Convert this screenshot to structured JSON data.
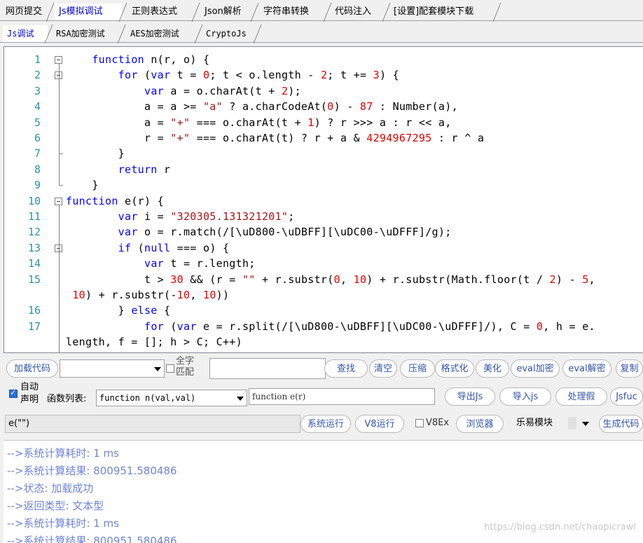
{
  "tabs": [
    "网页提交",
    "Js模拟调试",
    "正则表达式",
    "Json解析",
    "字符串转换",
    "代码注入",
    "[设置]配套模块下载"
  ],
  "subtabs": [
    "Js调试",
    "RSA加密测试",
    "AES加密测试",
    "CryptoJs"
  ],
  "code_lines": [
    {
      "n": "1",
      "text": "    function n(r, o) {"
    },
    {
      "n": "2",
      "text": "        for (var t = 0; t < o.length - 2; t += 3) {"
    },
    {
      "n": "3",
      "text": "            var a = o.charAt(t + 2);"
    },
    {
      "n": "4",
      "text": "            a = a >= \"a\" ? a.charCodeAt(0) - 87 : Number(a),"
    },
    {
      "n": "5",
      "text": "            a = \"+\" === o.charAt(t + 1) ? r >>> a : r << a,"
    },
    {
      "n": "6",
      "text": "            r = \"+\" === o.charAt(t) ? r + a & 4294967295 : r ^ a"
    },
    {
      "n": "7",
      "text": "        }"
    },
    {
      "n": "8",
      "text": "        return r"
    },
    {
      "n": "9",
      "text": "    }"
    },
    {
      "n": "10",
      "text": "function e(r) {"
    },
    {
      "n": "11",
      "text": "        var i = \"320305.131321201\";"
    },
    {
      "n": "12",
      "text": "        var o = r.match(/[\\uD800-\\uDBFF][\\uDC00-\\uDFFF]/g);"
    },
    {
      "n": "13",
      "text": "        if (null === o) {"
    },
    {
      "n": "14",
      "text": "            var t = r.length;"
    },
    {
      "n": "15",
      "text": "            t > 30 && (r = \"\" + r.substr(0, 10) + r.substr(Math.floor(t / 2) - 5,"
    },
    {
      "n": "",
      "text": " 10) + r.substr(-10, 10))"
    },
    {
      "n": "16",
      "text": "        } else {"
    },
    {
      "n": "17",
      "text": "            for (var e = r.split(/[\\uD800-\\uDBFF][\\uDC00-\\uDFFF]/), C = 0, h = e."
    },
    {
      "n": "",
      "text": "length, f = []; h > C; C++)"
    }
  ],
  "toolbar": {
    "load_code": "加载代码",
    "font_check_l1": "全字",
    "font_check_l2": "匹配",
    "find": "查找",
    "clear": "清空",
    "compress": "压缩",
    "format": "格式化",
    "beautify": "美化",
    "eval_encrypt": "eval加密",
    "eval_decrypt": "eval解密",
    "copy": "复制",
    "auto_declare_l1": "自动",
    "auto_declare_l2": "声明",
    "func_list_label": "函数列表:",
    "func_list_value": "function n(val,val)",
    "func_input_value": "function e(r)",
    "export_js": "导出Js",
    "import_js": "导入js",
    "process_fake": "处理假",
    "jsfuc": "Jsfuc",
    "call_input": "e(\"\")",
    "run_system": "系统运行",
    "run_v8": "V8运行",
    "v8ex": "V8Ex",
    "browser": "浏览器",
    "module_value": "乐易模块",
    "gen_code": "生成代码"
  },
  "output_lines": [
    "-->系统计算耗时: 1 ms",
    "-->系统计算结果: 800951.580486",
    "-->状态: 加载成功",
    "-->返回类型: 文本型",
    "-->系统计算耗时: 1 ms",
    "-->系统计算结果: 800951.580486"
  ],
  "watermark": "https://blog.csdn.net/chaopicrawl"
}
